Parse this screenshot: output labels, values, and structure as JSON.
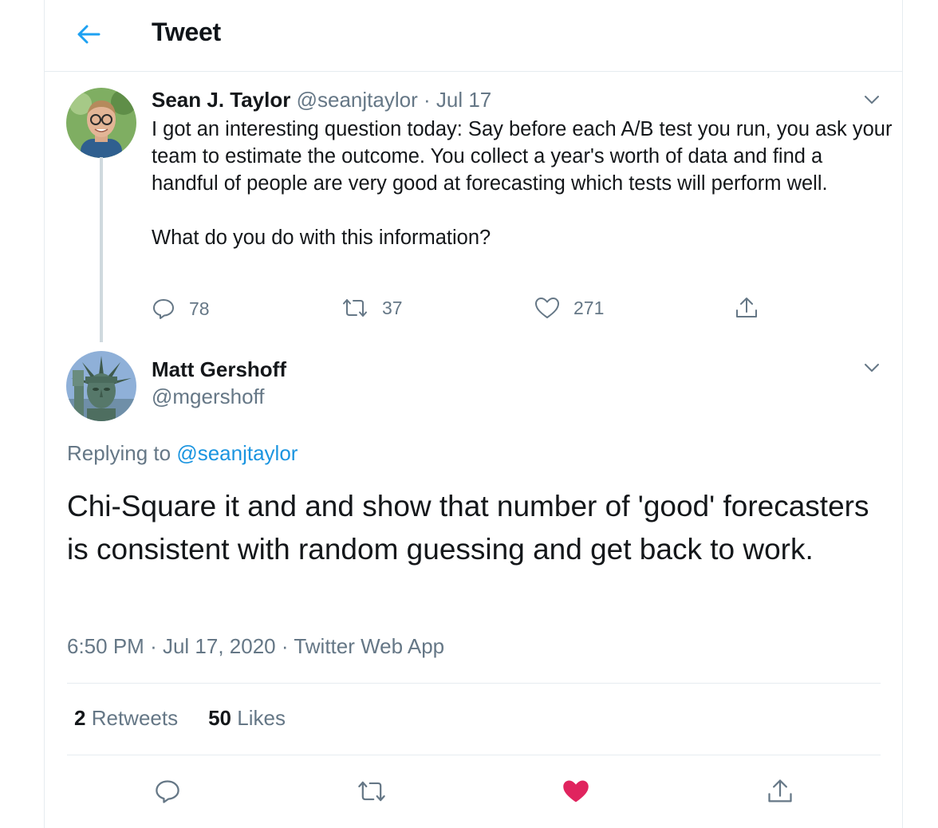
{
  "colors": {
    "accent": "#1da1f2",
    "muted": "#657786",
    "like": "#e0245e",
    "border": "#e6ecf0"
  },
  "header": {
    "title": "Tweet",
    "back_icon": "arrow-left-icon"
  },
  "parent_tweet": {
    "author_name": "Sean J. Taylor",
    "handle": "@seanjtaylor",
    "separator": "·",
    "date": "Jul 17",
    "text": "I got an interesting question today: Say before each A/B test you run, you ask your team to estimate the outcome. You collect a year's worth of data and find a handful of people are very good at forecasting which tests will perform well.\n\nWhat do you do with this information?",
    "actions": {
      "replies": "78",
      "retweets": "37",
      "likes": "271"
    }
  },
  "main_tweet": {
    "author_name": "Matt Gershoff",
    "handle": "@mgershoff",
    "replying_label": "Replying to",
    "replying_handle": "@seanjtaylor",
    "text": "Chi-Square it and and show that number of 'good' forecasters is consistent with random guessing and get back to work.",
    "time": "6:50 PM",
    "sep1": "·",
    "date": "Jul 17, 2020",
    "sep2": "·",
    "source": "Twitter Web App",
    "retweets_count": "2",
    "retweets_label": "Retweets",
    "likes_count": "50",
    "likes_label": "Likes",
    "liked": true
  }
}
